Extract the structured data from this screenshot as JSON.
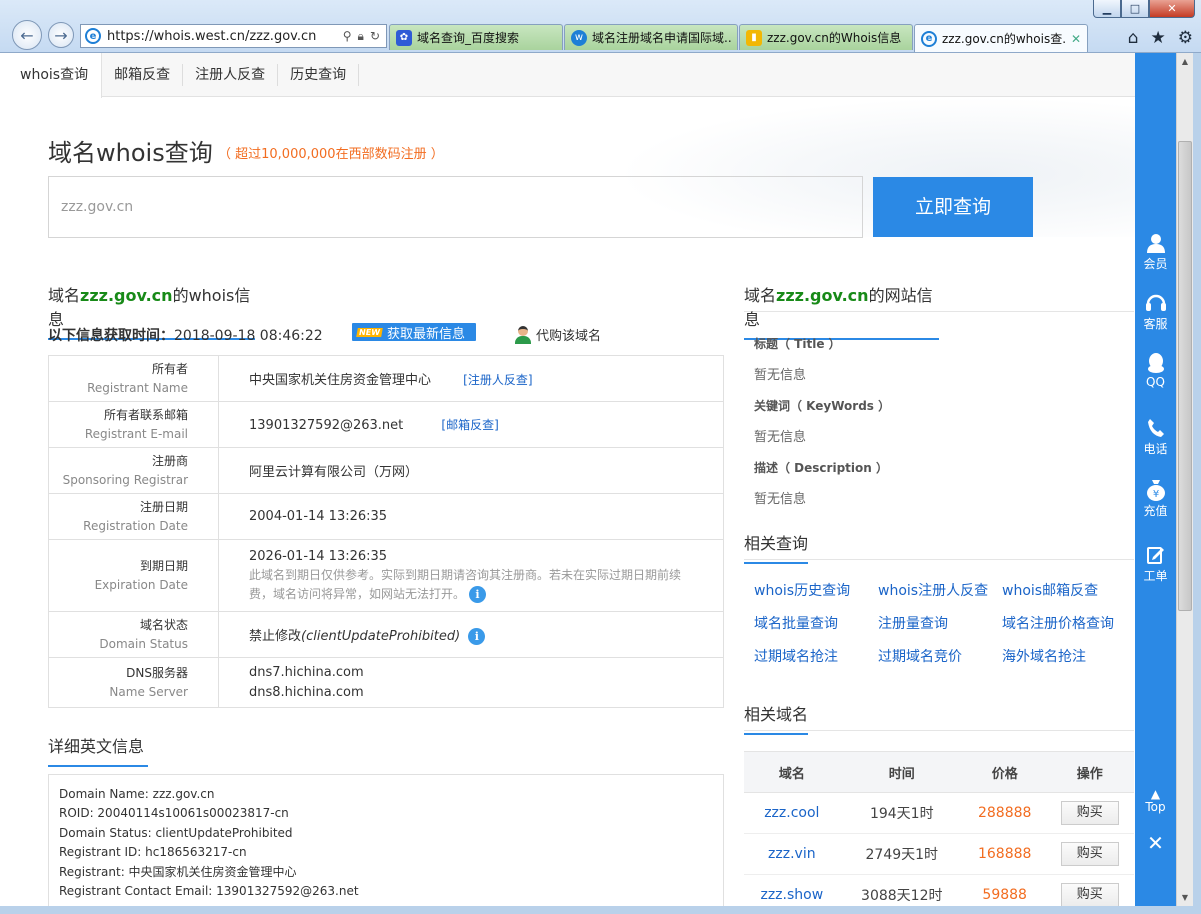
{
  "browser": {
    "url": "https://whois.west.cn/zzz.gov.cn",
    "tabs": [
      {
        "label": "域名查询_百度搜索",
        "active": false
      },
      {
        "label": "域名注册域名申请国际域...",
        "active": false
      },
      {
        "label": "zzz.gov.cn的Whois信息 ...",
        "active": false
      },
      {
        "label": "zzz.gov.cn的whois查...",
        "active": true
      }
    ]
  },
  "subnav": [
    "whois查询",
    "邮箱反查",
    "注册人反查",
    "历史查询"
  ],
  "header": {
    "title": "域名whois查询",
    "note": "（ 超过10,000,000在西部数码注册 ）"
  },
  "search": {
    "value": "zzz.gov.cn",
    "button": "立即查询"
  },
  "whois": {
    "title_prefix": "域名",
    "domain": "zzz.gov.cn",
    "title_suffix": "的whois信息",
    "fetch_label": "以下信息获取时间：",
    "fetch_time": "2018-09-18 08:46:22",
    "new_badge": "NEW",
    "refresh_label": "获取最新信息",
    "proxy_label": "代购该域名",
    "rows": {
      "registrant": {
        "cn": "所有者",
        "en": "Registrant Name",
        "value": "中央国家机关住房资金管理中心",
        "link": "[注册人反查]"
      },
      "email": {
        "cn": "所有者联系邮箱",
        "en": "Registrant E-mail",
        "value": "13901327592@263.net",
        "link": "[邮箱反查]"
      },
      "registrar": {
        "cn": "注册商",
        "en": "Sponsoring Registrar",
        "value": "阿里云计算有限公司（万网）"
      },
      "reg_date": {
        "cn": "注册日期",
        "en": "Registration Date",
        "value": "2004-01-14 13:26:35"
      },
      "exp_date": {
        "cn": "到期日期",
        "en": "Expiration Date",
        "value": "2026-01-14 13:26:35",
        "note1": "此域名到期日仅供参考。实际到期日期请咨询其注册商。若未在实际过期日期前续",
        "note2": "费，域名访问将异常，如网站无法打开。"
      },
      "status": {
        "cn": "域名状态",
        "en": "Domain Status",
        "value": "禁止修改",
        "value_em": "(clientUpdateProhibited)"
      },
      "dns": {
        "cn": "DNS服务器",
        "en": "Name Server",
        "value1": "dns7.hichina.com",
        "value2": "dns8.hichina.com"
      }
    }
  },
  "detail": {
    "title": "详细英文信息",
    "lines": [
      "Domain Name: zzz.gov.cn",
      "ROID: 20040114s10061s00023817-cn",
      "Domain Status: clientUpdateProhibited",
      "Registrant ID: hc186563217-cn",
      "Registrant: 中央国家机关住房资金管理中心",
      "Registrant Contact Email: 13901327592@263.net"
    ]
  },
  "site_info": {
    "title_prefix": "域名",
    "domain": "zzz.gov.cn",
    "title_suffix": "的网站信息",
    "title_label": "标题（ Title ）",
    "title_value": "暂无信息",
    "keywords_label": "关键词（ KeyWords ）",
    "keywords_value": "暂无信息",
    "desc_label": "描述（ Description ）",
    "desc_value": "暂无信息"
  },
  "related_queries": {
    "title": "相关查询",
    "links": [
      "whois历史查询",
      "whois注册人反查",
      "whois邮箱反查",
      "域名批量查询",
      "注册量查询",
      "域名注册价格查询",
      "过期域名抢注",
      "过期域名竞价",
      "海外域名抢注"
    ]
  },
  "related_domains": {
    "title": "相关域名",
    "headers": [
      "域名",
      "时间",
      "价格",
      "操作"
    ],
    "rows": [
      {
        "domain": "zzz.cool",
        "time": "194天1时",
        "price": "288888",
        "action": "购买"
      },
      {
        "domain": "zzz.vin",
        "time": "2749天1时",
        "price": "168888",
        "action": "购买"
      },
      {
        "domain": "zzz.show",
        "time": "3088天12时",
        "price": "59888",
        "action": "购买"
      }
    ]
  },
  "sidebar": {
    "items": [
      "会员",
      "客服",
      "QQ",
      "电话",
      "充值",
      "工单"
    ],
    "top": "Top",
    "close": "✕"
  },
  "colors": {
    "accent": "#2b89e5",
    "domain_green": "#188a18",
    "price_orange": "#f26d21",
    "link_blue": "#1a64c8"
  }
}
